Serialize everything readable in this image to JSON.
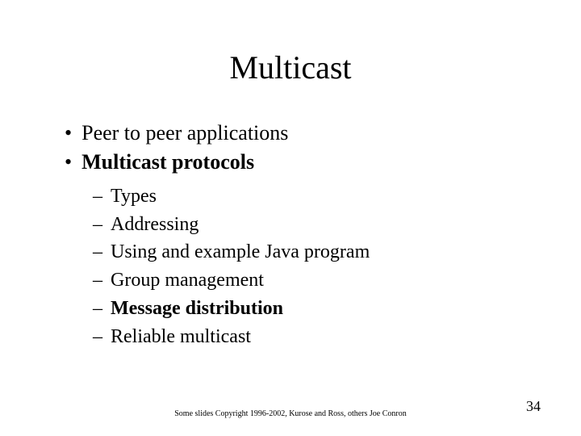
{
  "title": "Multicast",
  "bullets": [
    {
      "text": "Peer to peer applications",
      "bold": false
    },
    {
      "text": "Multicast protocols",
      "bold": true
    }
  ],
  "subbullets": [
    {
      "text": "Types",
      "bold": false
    },
    {
      "text": "Addressing",
      "bold": false
    },
    {
      "text": "Using and example Java program",
      "bold": false
    },
    {
      "text": "Group management",
      "bold": false
    },
    {
      "text": "Message distribution",
      "bold": true
    },
    {
      "text": "Reliable multicast",
      "bold": false
    }
  ],
  "footer_note": "Some slides Copyright 1996-2002, Kurose and Ross, others Joe Conron",
  "page_number": "34"
}
